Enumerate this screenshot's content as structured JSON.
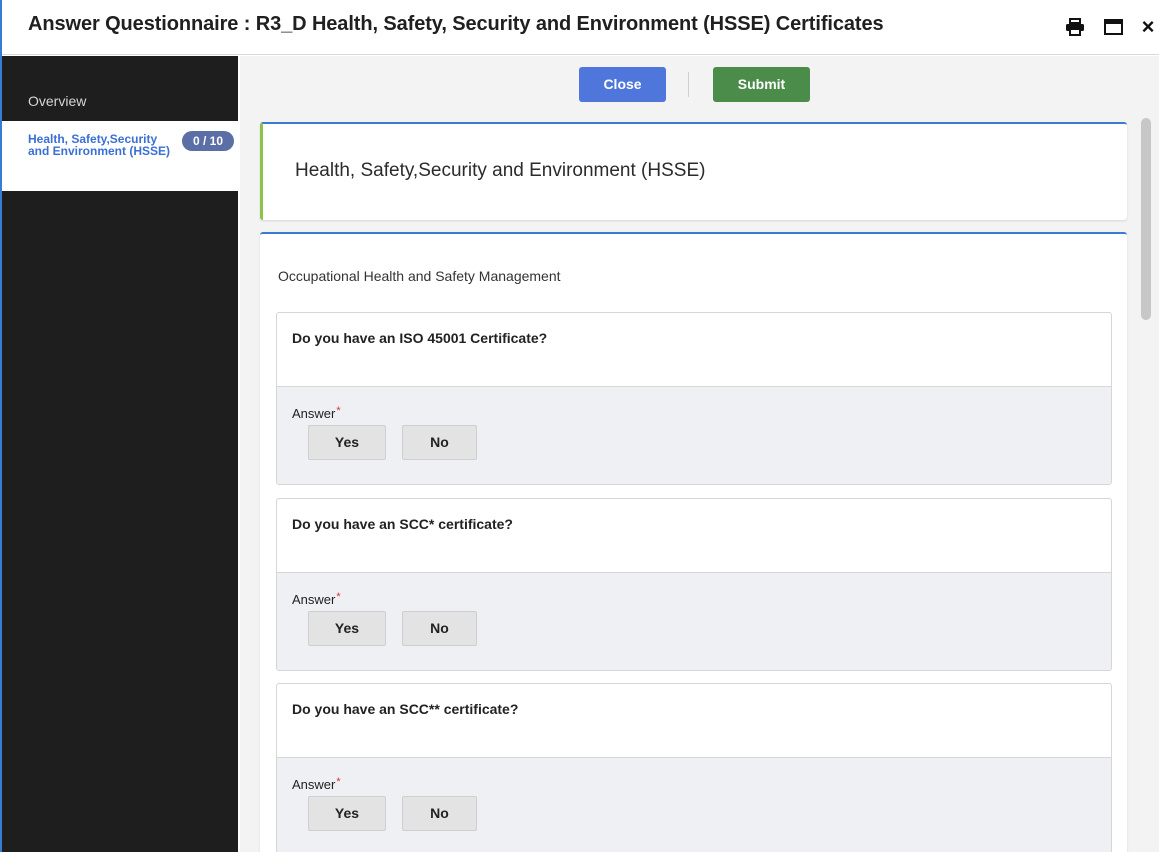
{
  "window": {
    "title": "Answer Questionnaire : R3_D Health, Safety, Security and Environment (HSSE) Certificates",
    "icons": [
      "print-icon",
      "maximize-icon",
      "close-icon"
    ],
    "close_glyph": "×",
    "accent_color": "#3b7ad1"
  },
  "sidebar": {
    "overview_label": "Overview",
    "items": [
      {
        "label": "Health, Safety,Security and Environment (HSSE)",
        "badge": "0 / 10"
      }
    ]
  },
  "toolbar": {
    "close_label": "Close",
    "submit_label": "Submit",
    "close_color": "#4f77db",
    "submit_color": "#4c8c4a"
  },
  "section": {
    "title": "Health, Safety,Security and Environment (HSSE)",
    "group_title": "Occupational Health and Safety Management"
  },
  "questions": [
    {
      "text": "Do you have an ISO 45001 Certificate?",
      "answer_label": "Answer",
      "required_mark": "*",
      "options": [
        "Yes",
        "No"
      ]
    },
    {
      "text": "Do you have an SCC* certificate?",
      "answer_label": "Answer",
      "required_mark": "*",
      "options": [
        "Yes",
        "No"
      ]
    },
    {
      "text": "Do you have an SCC** certificate?",
      "answer_label": "Answer",
      "required_mark": "*",
      "options": [
        "Yes",
        "No"
      ]
    }
  ]
}
